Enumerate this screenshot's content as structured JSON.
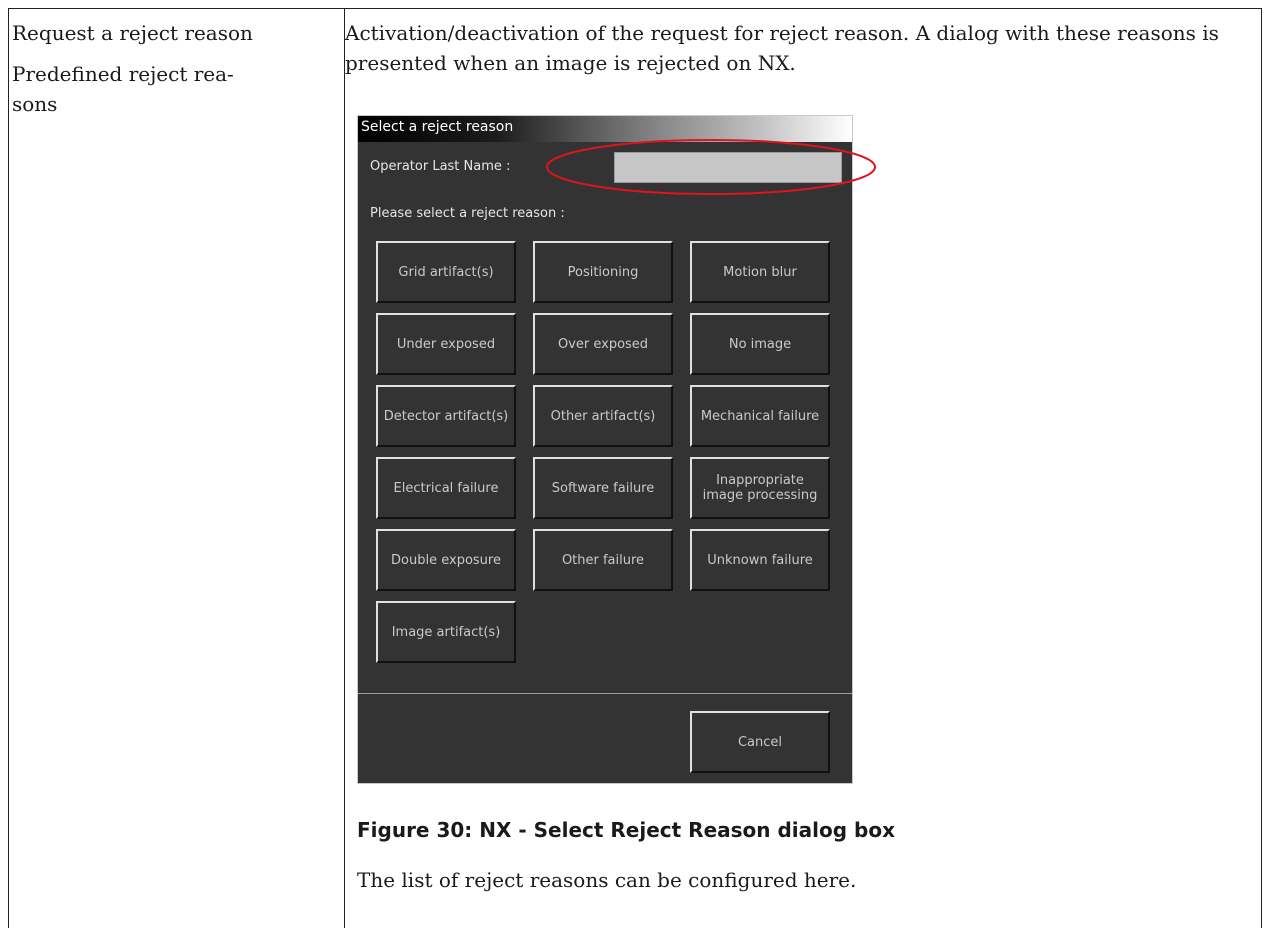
{
  "left": {
    "items": [
      "Request a reject reason",
      "Predefined reject rea-\nsons"
    ]
  },
  "right": {
    "description": "Activation/deactivation of the request for reject reason. A dialog with these reasons is presented when an image is rejected on NX.",
    "dialog": {
      "title": "Select a reject reason",
      "operator_label": "Operator Last Name :",
      "operator_value": "",
      "select_label": "Please select a reject reason :",
      "buttons": [
        "Grid artifact(s)",
        "Positioning",
        "Motion blur",
        "Under exposed",
        "Over exposed",
        "No image",
        "Detector artifact(s)",
        "Other artifact(s)",
        "Mechanical failure",
        "Electrical failure",
        "Software failure",
        "Inappropriate\nimage processing",
        "Double exposure",
        "Other failure",
        "Unknown failure",
        "Image artifact(s)"
      ],
      "cancel_label": "Cancel",
      "highlight_color": "#e0141c"
    },
    "caption": "Figure 30: NX - Select Reject Reason dialog box",
    "note": "The list of reject reasons can be configured here."
  }
}
